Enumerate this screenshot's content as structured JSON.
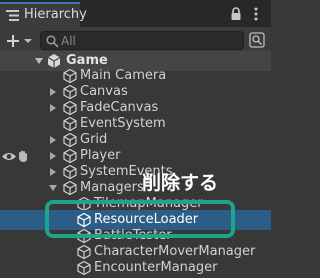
{
  "tab": {
    "title": "Hierarchy"
  },
  "search": {
    "placeholder": "All",
    "value": ""
  },
  "scene": {
    "name": "Game"
  },
  "items": [
    {
      "label": "Main Camera"
    },
    {
      "label": "Canvas"
    },
    {
      "label": "FadeCanvas"
    },
    {
      "label": "EventSystem"
    },
    {
      "label": "Grid"
    },
    {
      "label": "Player"
    },
    {
      "label": "SystemEvents"
    },
    {
      "label": "Managers"
    },
    {
      "label": "TilemapManager"
    },
    {
      "label": "ResourceLoader"
    },
    {
      "label": "BattleTester"
    },
    {
      "label": "CharacterMoverManager"
    },
    {
      "label": "EncounterManager"
    }
  ],
  "annotation": {
    "text": "削除する"
  },
  "colors": {
    "selection": "#2c5d87",
    "highlight": "#1fa38a",
    "tab_accent": "#3a79bb"
  }
}
